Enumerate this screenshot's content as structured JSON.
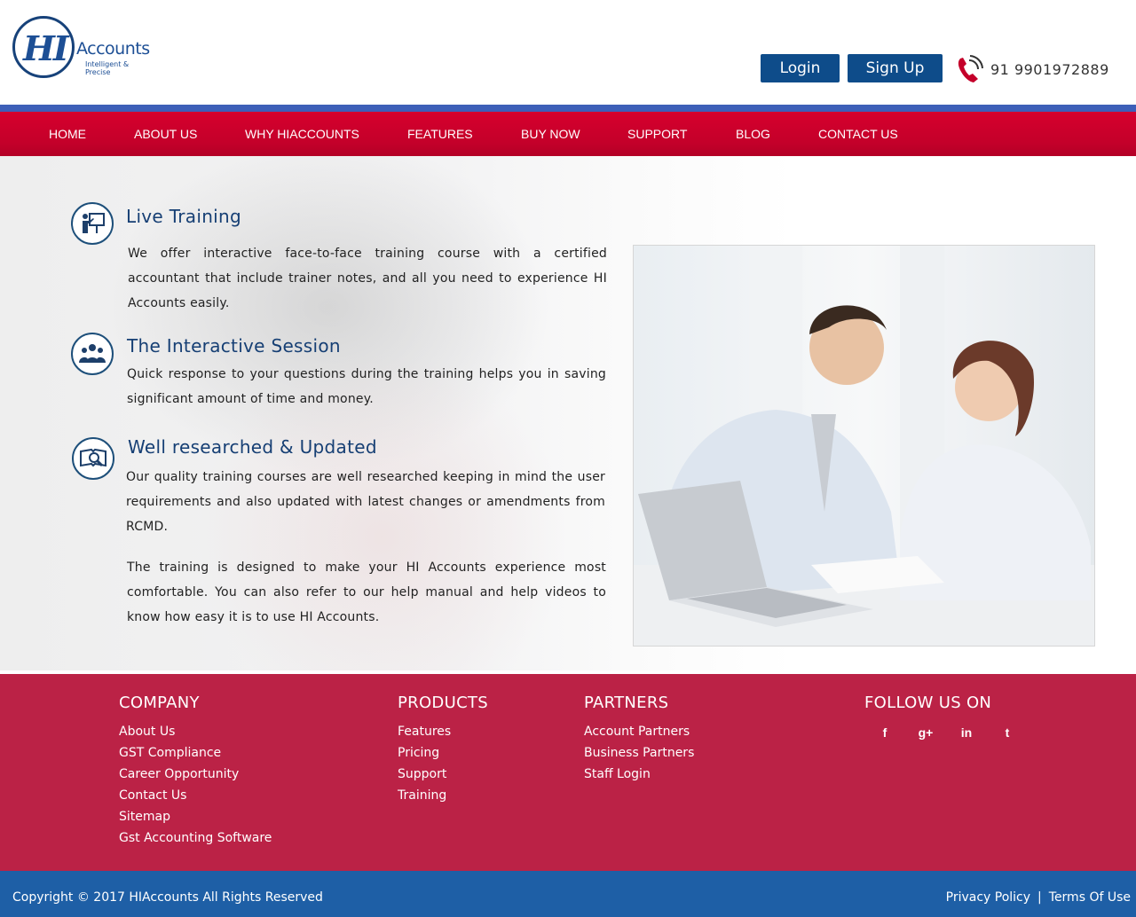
{
  "brand": {
    "logo_mark": "HI",
    "logo_text": "Accounts",
    "tagline": "Intelligent & Precise"
  },
  "header": {
    "login_label": "Login",
    "signup_label": "Sign Up",
    "phone": "91 9901972889"
  },
  "nav": {
    "items": [
      {
        "label": "HOME"
      },
      {
        "label": "ABOUT US"
      },
      {
        "label": "WHY HIACCOUNTS"
      },
      {
        "label": "FEATURES"
      },
      {
        "label": "BUY NOW"
      },
      {
        "label": "SUPPORT"
      },
      {
        "label": "BLOG"
      },
      {
        "label": "CONTACT US"
      }
    ]
  },
  "features": [
    {
      "icon": "trainer-icon",
      "title": "Live Training",
      "text": "We offer interactive face-to-face training course with a certified accountant that include trainer notes, and all you need to experience HI Accounts easily."
    },
    {
      "icon": "group-icon",
      "title": "The Interactive Session",
      "text": "Quick response to your questions during the training helps you in saving significant amount of time and money."
    },
    {
      "icon": "research-icon",
      "title": "Well researched & Updated",
      "text": "Our quality training courses are well researched keeping in mind the user requirements and also updated with latest changes or amendments from RCMD."
    }
  ],
  "closing_text": "The training is designed to make your HI Accounts experience most comfortable. You can also refer to our help manual and help videos to know how easy it is to use HI Accounts.",
  "footer": {
    "company": {
      "heading": "COMPANY",
      "links": [
        "About Us",
        "GST Compliance",
        "Career Opportunity",
        "Contact Us",
        "Sitemap",
        "Gst Accounting Software"
      ]
    },
    "products": {
      "heading": "PRODUCTS",
      "links": [
        "Features",
        "Pricing",
        "Support",
        "Training"
      ]
    },
    "partners": {
      "heading": "PARTNERS",
      "links": [
        "Account Partners",
        "Business Partners",
        "Staff Login"
      ]
    },
    "follow": {
      "heading": "FOLLOW US ON",
      "icons": [
        {
          "name": "facebook-icon",
          "glyph": "f"
        },
        {
          "name": "google-plus-icon",
          "glyph": "g+"
        },
        {
          "name": "linkedin-icon",
          "glyph": "in"
        },
        {
          "name": "twitter-icon",
          "glyph": "t"
        }
      ]
    }
  },
  "bottom": {
    "copyright": "Copyright © 2017 HIAccounts All Rights Reserved",
    "privacy": "Privacy Policy",
    "separator": "|",
    "terms": "Terms Of Use"
  },
  "colors": {
    "nav_red": "#c4002a",
    "nav_blue_strip": "#3d5fb8",
    "button_blue": "#0e4c8a",
    "footer_red": "#bb2246",
    "bottom_blue": "#1e5fa6",
    "title_blue": "#163f74"
  }
}
